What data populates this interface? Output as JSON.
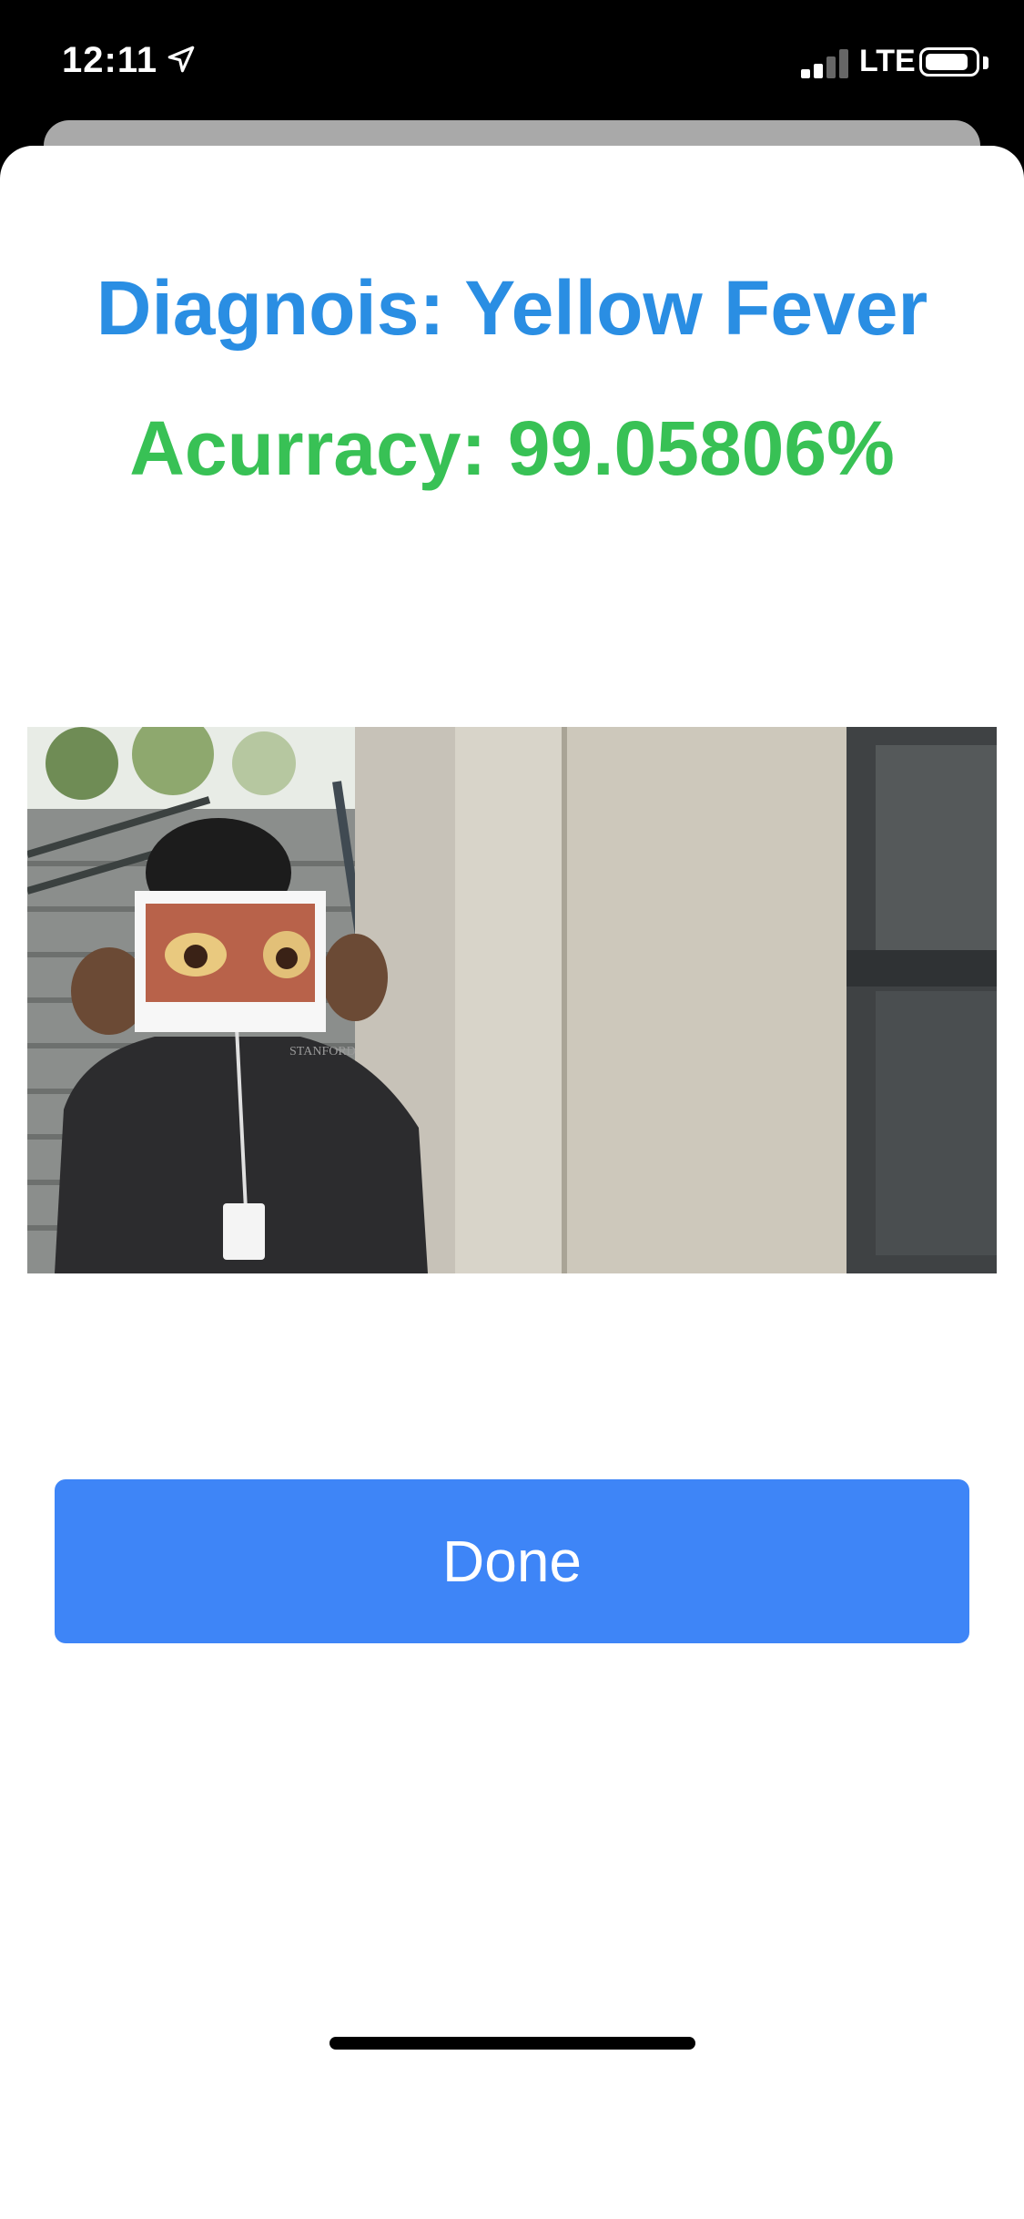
{
  "status_bar": {
    "time": "12:11",
    "network": "LTE",
    "signal_bars_active": 2,
    "signal_bars_total": 4
  },
  "result": {
    "diagnosis": "Diagnois: Yellow Fever",
    "accuracy": "Acurracy: 99.05806%"
  },
  "photo": {
    "badge_text": "STANFORD"
  },
  "actions": {
    "done_label": "Done"
  },
  "colors": {
    "diagnosis": "#2a8ee3",
    "accuracy": "#38c155",
    "button": "#3e85f7"
  }
}
